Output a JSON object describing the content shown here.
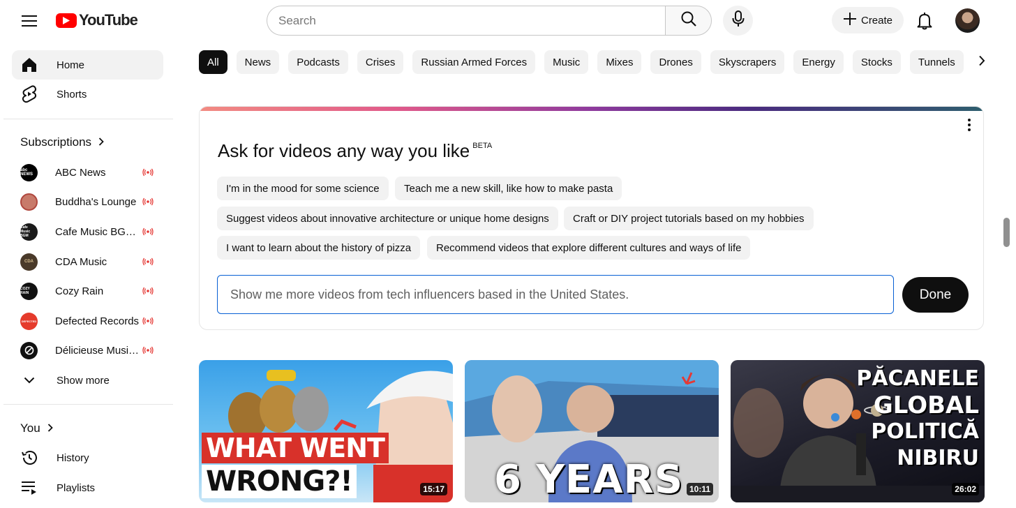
{
  "header": {
    "logo_text": "YouTube",
    "search_placeholder": "Search",
    "create_label": "Create"
  },
  "sidebar": {
    "main": [
      {
        "label": "Home",
        "icon": "home-icon",
        "active": true
      },
      {
        "label": "Shorts",
        "icon": "shorts-icon",
        "active": false
      }
    ],
    "subscriptions_heading": "Subscriptions",
    "subscriptions": [
      {
        "label": "ABC News",
        "avatar_text": "abc NEWS",
        "avatar_color": "#000000",
        "live": true
      },
      {
        "label": "Buddha's Lounge",
        "avatar_text": "",
        "avatar_color": "#b0483f",
        "live": true
      },
      {
        "label": "Cafe Music BGM channel",
        "avatar_text": "Cafe Music BGM",
        "avatar_color": "#1a1a1a",
        "live": true
      },
      {
        "label": "CDA Music",
        "avatar_text": "CDA",
        "avatar_color": "#4a3a2a",
        "live": true
      },
      {
        "label": "Cozy Rain",
        "avatar_text": "COZY RAIN",
        "avatar_color": "#111111",
        "live": true
      },
      {
        "label": "Defected Records",
        "avatar_text": "DEFECTED",
        "avatar_color": "#e53b2c",
        "live": true
      },
      {
        "label": "Délicieuse Musique",
        "avatar_text": "",
        "avatar_color": "#111111",
        "live": true
      }
    ],
    "show_more": "Show more",
    "you_heading": "You",
    "you_items": [
      {
        "label": "History",
        "icon": "history-icon"
      },
      {
        "label": "Playlists",
        "icon": "playlists-icon"
      }
    ]
  },
  "chips": [
    "All",
    "News",
    "Podcasts",
    "Crises",
    "Russian Armed Forces",
    "Music",
    "Mixes",
    "Drones",
    "Skyscrapers",
    "Energy",
    "Stocks",
    "Tunnels"
  ],
  "ask": {
    "title": "Ask for videos any way you like",
    "badge": "BETA",
    "prompts": [
      "I'm in the mood for some science",
      "Teach me a new skill, like how to make pasta",
      "Suggest videos about innovative architecture or unique home designs",
      "Craft or DIY project tutorials based on my hobbies",
      "I want to learn about the history of pizza",
      "Recommend videos that explore different cultures and ways of life"
    ],
    "input_value": "Show me more videos from tech influencers based in the United States.",
    "done_label": "Done"
  },
  "videos": [
    {
      "thumb_text_1": "WHAT WENT",
      "thumb_text_2": "WRONG?!",
      "duration": "15:17"
    },
    {
      "thumb_text_1": "6 YEARS",
      "duration": "10:11"
    },
    {
      "thumb_text_1": "PĂCANELE",
      "thumb_text_2": "GLOBAL",
      "thumb_text_3": "POLITICĂ",
      "thumb_text_4": "NIBIRU",
      "duration": "26:02"
    }
  ],
  "colors": {
    "brand_red": "#ff0000",
    "live_red": "#e53935",
    "input_focus_blue": "#065fd4"
  }
}
